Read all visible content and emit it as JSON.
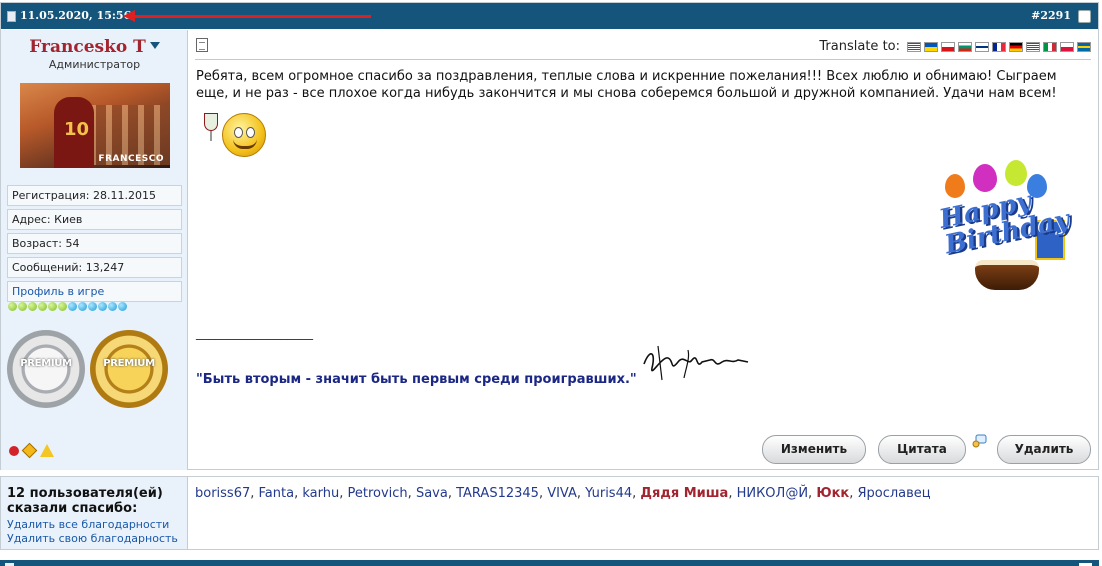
{
  "post": {
    "date": "11.05.2020, 15:56",
    "number": "#2291"
  },
  "user": {
    "name": "Francesko T",
    "role": "Администратор",
    "avatar_caption": "FRANCESCO",
    "avatar_jersey": "10",
    "info": [
      "Регистрация: 28.11.2015",
      "Адрес: Киев",
      "Возраст: 54",
      "Сообщений: 13,247"
    ],
    "profile_link": "Профиль в игре",
    "medals": [
      "PREMIUM",
      "PREMIUM"
    ]
  },
  "translate": {
    "label": "Translate to:",
    "flags": [
      "us",
      "ua",
      "cz",
      "bg",
      "fi",
      "fr",
      "de",
      "gr",
      "it",
      "pl",
      "se"
    ]
  },
  "message": {
    "text": "Ребята, всем огромное спасибо за поздравления, теплые слова и искренние пожелания!!! Всех люблю и обнимаю! Сыграем еще, и не раз - все плохое когда нибудь закончится и мы снова соберемся большой и дружной компанией. Удачи нам всем!",
    "image_text": "Happy Birthday"
  },
  "signature": {
    "line": "__________________",
    "quote": "\"Быть вторым - значит быть первым среди проигравших.\""
  },
  "buttons": {
    "edit": "Изменить",
    "quote": "Цитата",
    "delete": "Удалить"
  },
  "thanks": {
    "title": "12 пользователя(ей) сказали спасибо:",
    "remove_all": "Удалить все благодарности",
    "remove_own": "Удалить свою благодарность",
    "names": [
      {
        "name": "boriss67",
        "bold": false
      },
      {
        "name": "Fanta",
        "bold": false
      },
      {
        "name": "karhu",
        "bold": false
      },
      {
        "name": "Petrovich",
        "bold": false
      },
      {
        "name": "Sava",
        "bold": false
      },
      {
        "name": "TARAS12345",
        "bold": false
      },
      {
        "name": "VIVA",
        "bold": false
      },
      {
        "name": "Yuris44",
        "bold": false
      },
      {
        "name": "Дядя Миша",
        "bold": true
      },
      {
        "name": "НИКОЛ@Й",
        "bold": false
      },
      {
        "name": "Юкк",
        "bold": true
      },
      {
        "name": "Ярославец",
        "bold": false
      }
    ]
  },
  "colors": {
    "header": "#15557c",
    "username": "#a1242f",
    "link": "#1a58a8",
    "quote": "#1b2784",
    "arrow": "#e02020"
  }
}
